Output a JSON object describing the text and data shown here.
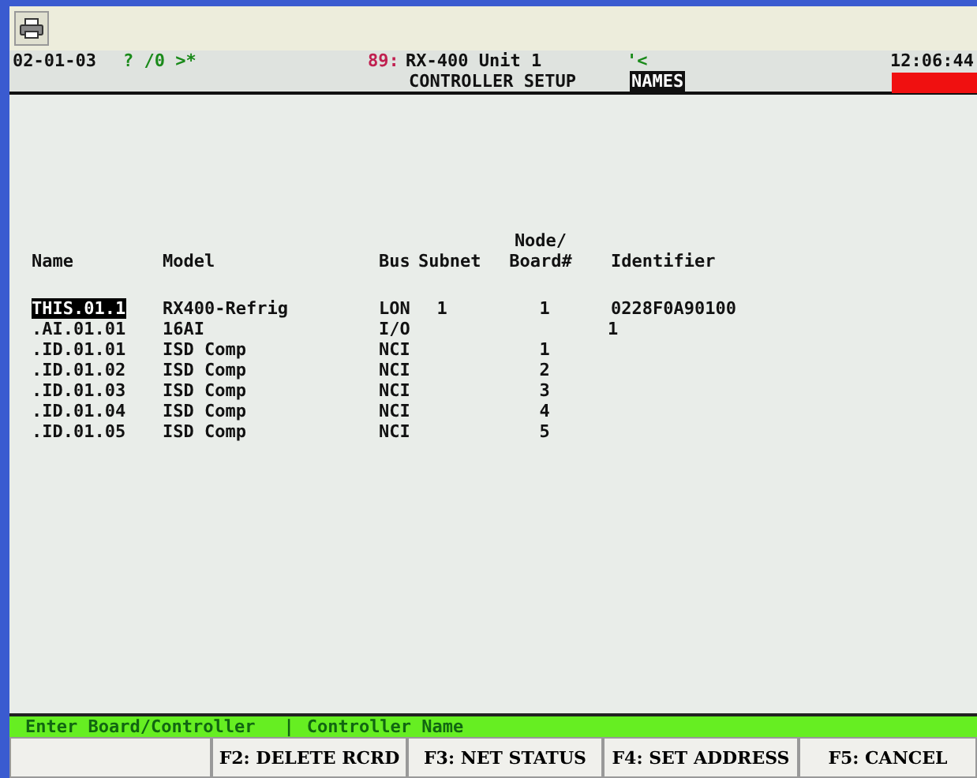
{
  "header": {
    "date": "02-01-03",
    "status_chars": "? /0 >*",
    "unit_number": "89:",
    "unit_name": "RX-400 Unit 1",
    "signal_chars": "'<",
    "time": "12:06:44",
    "screen_title": "CONTROLLER SETUP",
    "screen_mode": "NAMES",
    "alarm": true
  },
  "table": {
    "columns": [
      "Name",
      "Model",
      "Bus",
      "Subnet",
      "Node/ Board#",
      "Identifier"
    ],
    "rows": [
      {
        "name": "THIS.01.1",
        "model": "RX400-Refrig",
        "bus": "LON",
        "subnet": "1",
        "node": "1",
        "node_shifted": false,
        "identifier": "0228F0A90100",
        "selected": true
      },
      {
        "name": ".AI.01.01",
        "model": "16AI",
        "bus": "I/O",
        "node": "1",
        "node_shifted": true,
        "selected": false
      },
      {
        "name": ".ID.01.01",
        "model": "ISD Comp",
        "bus": "NCI",
        "node": "1",
        "node_shifted": false,
        "selected": false
      },
      {
        "name": ".ID.01.02",
        "model": "ISD Comp",
        "bus": "NCI",
        "node": "2",
        "node_shifted": false,
        "selected": false
      },
      {
        "name": ".ID.01.03",
        "model": "ISD Comp",
        "bus": "NCI",
        "node": "3",
        "node_shifted": false,
        "selected": false
      },
      {
        "name": ".ID.01.04",
        "model": "ISD Comp",
        "bus": "NCI",
        "node": "4",
        "node_shifted": false,
        "selected": false
      },
      {
        "name": ".ID.01.05",
        "model": "ISD Comp",
        "bus": "NCI",
        "node": "5",
        "node_shifted": false,
        "selected": false
      }
    ]
  },
  "status_bar": {
    "prompt": "Enter Board/Controller",
    "separator": "|",
    "field": "Controller Name"
  },
  "function_keys": [
    "F2: DELETE RCRD",
    "F3: NET STATUS",
    "F4: SET ADDRESS",
    "F5: CANCEL"
  ]
}
